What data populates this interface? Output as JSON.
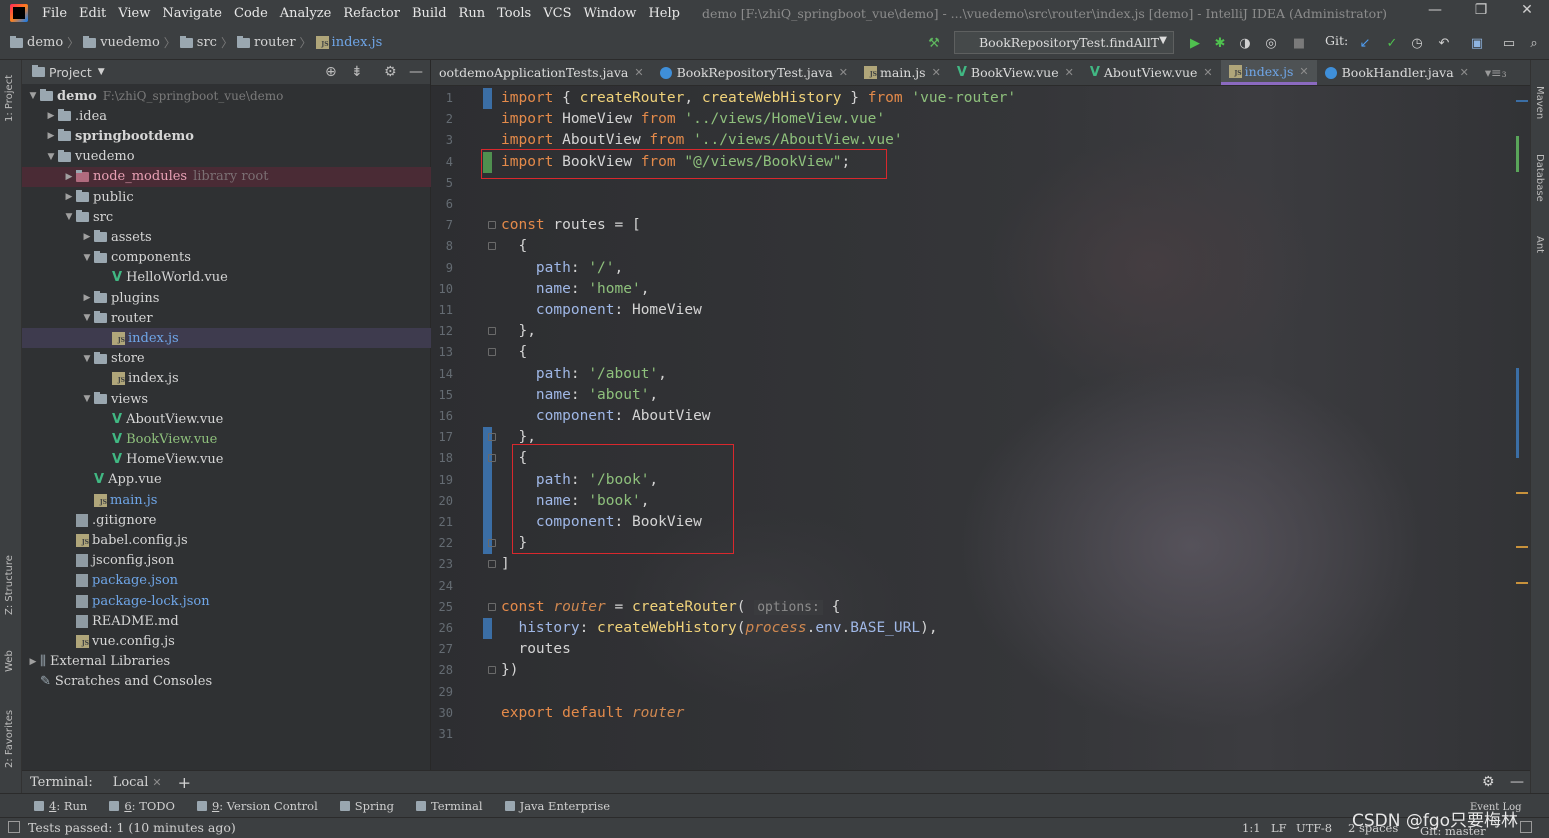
{
  "menu": {
    "items": [
      "File",
      "Edit",
      "View",
      "Navigate",
      "Code",
      "Analyze",
      "Refactor",
      "Build",
      "Run",
      "Tools",
      "VCS",
      "Window",
      "Help"
    ],
    "window_title": "demo [F:\\zhiQ_springboot_vue\\demo] - ...\\vuedemo\\src\\router\\index.js [demo] - IntelliJ IDEA (Administrator)"
  },
  "breadcrumb": [
    "demo",
    "vuedemo",
    "src",
    "router",
    "index.js"
  ],
  "toolbar": {
    "run_config": "BookRepositoryTest.findAllT",
    "git_label": "Git:"
  },
  "project": {
    "title": "Project",
    "root_name": "demo",
    "root_path": "F:\\zhiQ_springboot_vue\\demo",
    "library_root": "library root",
    "tree": [
      {
        "label": "demo",
        "depth": 0,
        "kind": "folder",
        "arrow": "▼"
      },
      {
        "label": ".idea",
        "depth": 1,
        "kind": "folder",
        "arrow": "▶"
      },
      {
        "label": "springbootdemo",
        "depth": 1,
        "kind": "folder",
        "arrow": "▶"
      },
      {
        "label": "vuedemo",
        "depth": 1,
        "kind": "folder",
        "arrow": "▼"
      },
      {
        "label": "node_modules",
        "depth": 2,
        "kind": "folder",
        "arrow": "▶",
        "excluded": true
      },
      {
        "label": "public",
        "depth": 2,
        "kind": "folder",
        "arrow": "▶"
      },
      {
        "label": "src",
        "depth": 2,
        "kind": "folder",
        "arrow": "▼"
      },
      {
        "label": "assets",
        "depth": 3,
        "kind": "folder",
        "arrow": "▶"
      },
      {
        "label": "components",
        "depth": 3,
        "kind": "folder",
        "arrow": "▼"
      },
      {
        "label": "HelloWorld.vue",
        "depth": 4,
        "kind": "vue",
        "arrow": ""
      },
      {
        "label": "plugins",
        "depth": 3,
        "kind": "folder",
        "arrow": "▶"
      },
      {
        "label": "router",
        "depth": 3,
        "kind": "folder",
        "arrow": "▼"
      },
      {
        "label": "index.js",
        "depth": 4,
        "kind": "js",
        "arrow": "",
        "selected": true,
        "color": "#6fa6e8"
      },
      {
        "label": "store",
        "depth": 3,
        "kind": "folder",
        "arrow": "▼"
      },
      {
        "label": "index.js",
        "depth": 4,
        "kind": "js",
        "arrow": ""
      },
      {
        "label": "views",
        "depth": 3,
        "kind": "folder",
        "arrow": "▼"
      },
      {
        "label": "AboutView.vue",
        "depth": 4,
        "kind": "vue",
        "arrow": ""
      },
      {
        "label": "BookView.vue",
        "depth": 4,
        "kind": "vue",
        "arrow": "",
        "color": "#8ec07c"
      },
      {
        "label": "HomeView.vue",
        "depth": 4,
        "kind": "vue",
        "arrow": ""
      },
      {
        "label": "App.vue",
        "depth": 3,
        "kind": "vue",
        "arrow": ""
      },
      {
        "label": "main.js",
        "depth": 3,
        "kind": "js",
        "arrow": "",
        "color": "#6fa6e8"
      },
      {
        "label": ".gitignore",
        "depth": 2,
        "kind": "file",
        "arrow": ""
      },
      {
        "label": "babel.config.js",
        "depth": 2,
        "kind": "js",
        "arrow": ""
      },
      {
        "label": "jsconfig.json",
        "depth": 2,
        "kind": "file",
        "arrow": ""
      },
      {
        "label": "package.json",
        "depth": 2,
        "kind": "file",
        "arrow": "",
        "color": "#6fa6e8"
      },
      {
        "label": "package-lock.json",
        "depth": 2,
        "kind": "file",
        "arrow": "",
        "color": "#6fa6e8"
      },
      {
        "label": "README.md",
        "depth": 2,
        "kind": "file",
        "arrow": ""
      },
      {
        "label": "vue.config.js",
        "depth": 2,
        "kind": "js",
        "arrow": ""
      },
      {
        "label": "External Libraries",
        "depth": 0,
        "kind": "lib",
        "arrow": "▶"
      },
      {
        "label": "Scratches and Consoles",
        "depth": 0,
        "kind": "scratch",
        "arrow": ""
      }
    ]
  },
  "tabs": [
    {
      "label": "ootdemoApplicationTests.java",
      "icon": "",
      "active": false
    },
    {
      "label": "BookRepositoryTest.java",
      "icon": "class",
      "active": false
    },
    {
      "label": "main.js",
      "icon": "js",
      "active": false
    },
    {
      "label": "BookView.vue",
      "icon": "vue",
      "active": false
    },
    {
      "label": "AboutView.vue",
      "icon": "vue",
      "active": false
    },
    {
      "label": "index.js",
      "icon": "js",
      "active": true
    },
    {
      "label": "BookHandler.java",
      "icon": "class",
      "active": false
    }
  ],
  "code": [
    [
      [
        "kw",
        "import"
      ],
      [
        "t",
        " { "
      ],
      [
        "fn",
        "createRouter"
      ],
      [
        "t",
        ", "
      ],
      [
        "fn",
        "createWebHistory"
      ],
      [
        "t",
        " } "
      ],
      [
        "kw",
        "from"
      ],
      [
        "t",
        " "
      ],
      [
        "str",
        "'vue-router'"
      ]
    ],
    [
      [
        "kw",
        "import"
      ],
      [
        "t",
        " HomeView "
      ],
      [
        "kw",
        "from"
      ],
      [
        "t",
        " "
      ],
      [
        "str",
        "'../views/HomeView.vue'"
      ]
    ],
    [
      [
        "kw",
        "import"
      ],
      [
        "t",
        " AboutView "
      ],
      [
        "kw",
        "from"
      ],
      [
        "t",
        " "
      ],
      [
        "str",
        "'../views/AboutView.vue'"
      ]
    ],
    [
      [
        "kw",
        "import"
      ],
      [
        "t",
        " BookView "
      ],
      [
        "kw",
        "from"
      ],
      [
        "t",
        " "
      ],
      [
        "str",
        "\"@/views/BookView\""
      ],
      [
        "t",
        ";"
      ]
    ],
    [],
    [],
    [
      [
        "kw",
        "const"
      ],
      [
        "t",
        " routes = ["
      ]
    ],
    [
      [
        "t",
        "  {"
      ]
    ],
    [
      [
        "t",
        "    "
      ],
      [
        "prop",
        "path"
      ],
      [
        "t",
        ": "
      ],
      [
        "str",
        "'/'"
      ],
      [
        "t",
        ","
      ]
    ],
    [
      [
        "t",
        "    "
      ],
      [
        "prop",
        "name"
      ],
      [
        "t",
        ": "
      ],
      [
        "str",
        "'home'"
      ],
      [
        "t",
        ","
      ]
    ],
    [
      [
        "t",
        "    "
      ],
      [
        "prop",
        "component"
      ],
      [
        "t",
        ": HomeView"
      ]
    ],
    [
      [
        "t",
        "  },"
      ]
    ],
    [
      [
        "t",
        "  {"
      ]
    ],
    [
      [
        "t",
        "    "
      ],
      [
        "prop",
        "path"
      ],
      [
        "t",
        ": "
      ],
      [
        "str",
        "'/about'"
      ],
      [
        "t",
        ","
      ]
    ],
    [
      [
        "t",
        "    "
      ],
      [
        "prop",
        "name"
      ],
      [
        "t",
        ": "
      ],
      [
        "str",
        "'about'"
      ],
      [
        "t",
        ","
      ]
    ],
    [
      [
        "t",
        "    "
      ],
      [
        "prop",
        "component"
      ],
      [
        "t",
        ": AboutView"
      ]
    ],
    [
      [
        "t",
        "  },"
      ]
    ],
    [
      [
        "t",
        "  {"
      ]
    ],
    [
      [
        "t",
        "    "
      ],
      [
        "prop",
        "path"
      ],
      [
        "t",
        ": "
      ],
      [
        "str",
        "'/book'"
      ],
      [
        "t",
        ","
      ]
    ],
    [
      [
        "t",
        "    "
      ],
      [
        "prop",
        "name"
      ],
      [
        "t",
        ": "
      ],
      [
        "str",
        "'book'"
      ],
      [
        "t",
        ","
      ]
    ],
    [
      [
        "t",
        "    "
      ],
      [
        "prop",
        "component"
      ],
      [
        "t",
        ": BookView"
      ]
    ],
    [
      [
        "t",
        "  }"
      ]
    ],
    [
      [
        "t",
        "]"
      ]
    ],
    [],
    [
      [
        "kw",
        "const"
      ],
      [
        "t",
        " "
      ],
      [
        "ital",
        "router"
      ],
      [
        "t",
        " = "
      ],
      [
        "fn",
        "createRouter"
      ],
      [
        "t",
        "( "
      ],
      [
        "hint",
        "options:"
      ],
      [
        "t",
        " {"
      ]
    ],
    [
      [
        "t",
        "  "
      ],
      [
        "prop",
        "history"
      ],
      [
        "t",
        ": "
      ],
      [
        "fn",
        "createWebHistory"
      ],
      [
        "t",
        "("
      ],
      [
        "ital",
        "process"
      ],
      [
        "t",
        "."
      ],
      [
        "prop",
        "env"
      ],
      [
        "t",
        "."
      ],
      [
        "prop",
        "BASE_URL"
      ],
      [
        "t",
        "),"
      ]
    ],
    [
      [
        "t",
        "  routes"
      ]
    ],
    [
      [
        "t",
        "})"
      ]
    ],
    [],
    [
      [
        "kw",
        "export default"
      ],
      [
        "t",
        " "
      ],
      [
        "ital",
        "router"
      ]
    ],
    []
  ],
  "terminal": {
    "label": "Terminal:",
    "tab": "Local"
  },
  "tool_windows": [
    {
      "num": "4",
      "label": ": Run"
    },
    {
      "num": "6",
      "label": ": TODO"
    },
    {
      "num": "9",
      "label": ": Version Control"
    },
    {
      "num": "",
      "label": "Spring"
    },
    {
      "num": "",
      "label": "Terminal"
    },
    {
      "num": "",
      "label": "Java Enterprise"
    }
  ],
  "side_tools": {
    "project": "1: Project",
    "structure": "Z: Structure",
    "web": "Web",
    "favorites": "2: Favorites",
    "maven": "Maven",
    "database": "Database",
    "ant": "Ant"
  },
  "status": {
    "message": "Tests passed: 1 (10 minutes ago)",
    "position": "1:1",
    "line_sep": "LF",
    "encoding": "UTF-8",
    "indent": "2 spaces",
    "git_branch": "Git: master",
    "event_log": "Event Log"
  },
  "watermark": "CSDN @fgo只要梅林"
}
